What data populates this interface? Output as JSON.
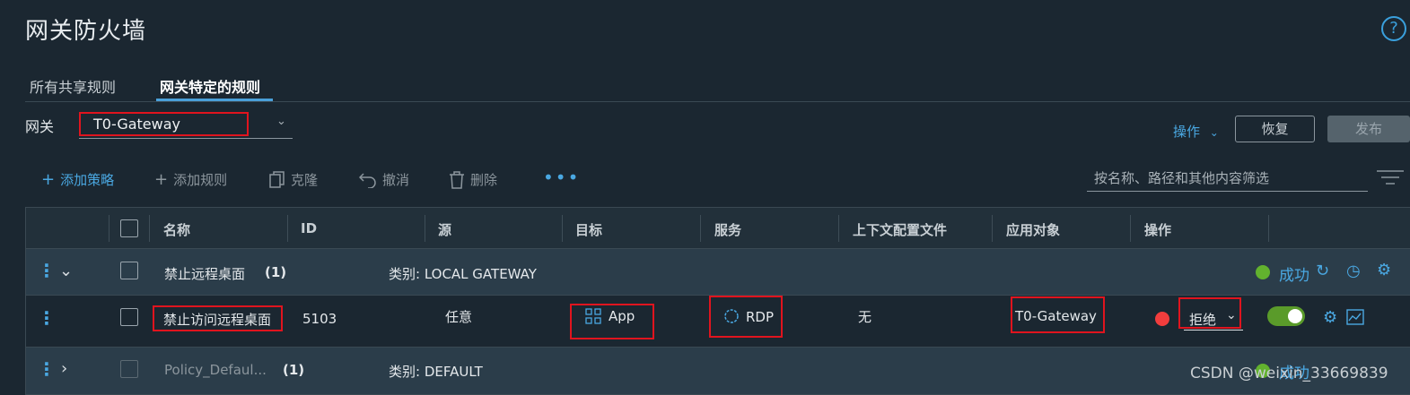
{
  "page": {
    "title": "网关防火墙",
    "help": "?"
  },
  "tabs": [
    {
      "label": "所有共享规则",
      "active": false
    },
    {
      "label": "网关特定的规则",
      "active": true
    }
  ],
  "gateway": {
    "label": "网关",
    "value": "T0-Gateway"
  },
  "header_actions": {
    "actions_label": "操作",
    "revert_label": "恢复",
    "publish_label": "发布"
  },
  "toolbar": {
    "add_policy": "添加策略",
    "add_rule": "添加规则",
    "clone": "克隆",
    "undo": "撤消",
    "delete": "删除",
    "more": "•••",
    "filter_placeholder": "按名称、路径和其他内容筛选"
  },
  "columns": [
    "名称",
    "ID",
    "源",
    "目标",
    "服务",
    "上下文配置文件",
    "应用对象",
    "操作"
  ],
  "policies": [
    {
      "name": "禁止远程桌面",
      "count": "(1)",
      "category": "类别: LOCAL GATEWAY",
      "status": "成功",
      "expanded": true,
      "rules": [
        {
          "name": "禁止访问远程桌面",
          "id": "5103",
          "source": "任意",
          "destination": "App",
          "service": "RDP",
          "context_profile": "无",
          "applied_to": "T0-Gateway",
          "action": "拒绝",
          "enabled": true
        }
      ]
    },
    {
      "name": "Policy_Defaul...",
      "count": "(1)",
      "category": "类别: DEFAULT",
      "status": "成功",
      "expanded": false
    }
  ],
  "watermark": "CSDN @weixin_33669839",
  "colors": {
    "accent": "#4aa8e2",
    "success": "#62b22e",
    "reject": "#f23d3d",
    "highlight_box": "#e0141e"
  }
}
